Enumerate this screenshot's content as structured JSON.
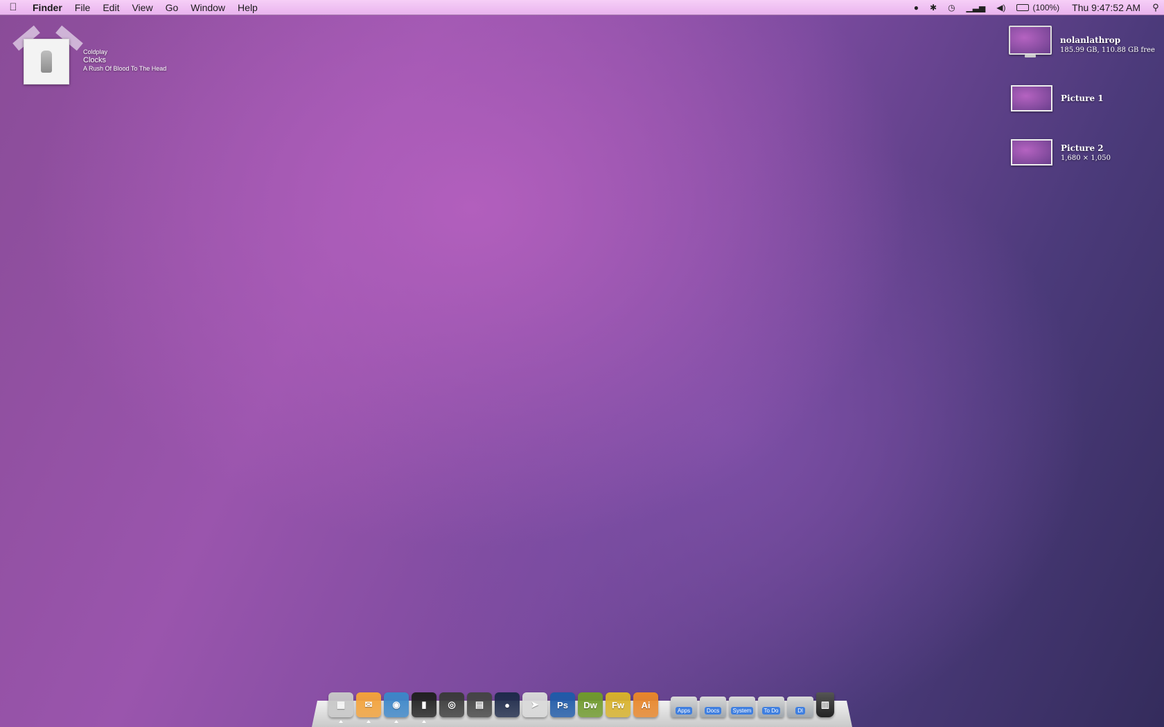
{
  "menubar": {
    "apple_icon": "apple-logo-icon",
    "app_name": "Finder",
    "items": [
      "File",
      "Edit",
      "View",
      "Go",
      "Window",
      "Help"
    ],
    "status_icons": [
      "bluetooth-icon",
      "time-machine-icon",
      "wifi-icon",
      "volume-icon"
    ],
    "battery_percent": "(100%)",
    "clock": "Thu 9:47:52 AM",
    "spotlight_icon": "spotlight-search-icon"
  },
  "now_playing": {
    "artist": "Coldplay",
    "song": "Clocks",
    "album": "A Rush Of Blood To The Head"
  },
  "desktop": {
    "drive": {
      "name": "nolanlathrop",
      "detail": "185.99 GB, 110.88 GB free"
    },
    "picture1": {
      "name": "Picture 1"
    },
    "picture2": {
      "name": "Picture 2",
      "detail": "1,680 × 1,050"
    }
  },
  "dock": {
    "apps": [
      {
        "name": "finder-icon",
        "glyph": "▦",
        "color": "#c7c7c7",
        "running": true
      },
      {
        "name": "mail-icon",
        "glyph": "✉",
        "color": "#f3a23a",
        "running": true
      },
      {
        "name": "browser-globe-icon",
        "glyph": "◉",
        "color": "#3c86c8",
        "running": true
      },
      {
        "name": "phone-icon",
        "glyph": "▮",
        "color": "#202020",
        "running": true
      },
      {
        "name": "camera-icon",
        "glyph": "◎",
        "color": "#3a3a3a",
        "running": false
      },
      {
        "name": "film-icon",
        "glyph": "▤",
        "color": "#444444",
        "running": false
      },
      {
        "name": "lens-icon",
        "glyph": "●",
        "color": "#1e2a4a",
        "running": false
      },
      {
        "name": "paper-plane-icon",
        "glyph": "➤",
        "color": "#d8d8d8",
        "running": false
      },
      {
        "name": "photoshop-icon",
        "glyph": "Ps",
        "color": "#1f5aa8",
        "running": false
      },
      {
        "name": "dreamweaver-icon",
        "glyph": "Dw",
        "color": "#6f9a2c",
        "running": false
      },
      {
        "name": "fireworks-icon",
        "glyph": "Fw",
        "color": "#d8b22a",
        "running": false
      },
      {
        "name": "illustrator-icon",
        "glyph": "Ai",
        "color": "#e8862a",
        "running": false
      }
    ],
    "folders": [
      "Apps",
      "Docs",
      "System",
      "To Do",
      "Dl"
    ],
    "trash_icon": "trash-icon"
  }
}
